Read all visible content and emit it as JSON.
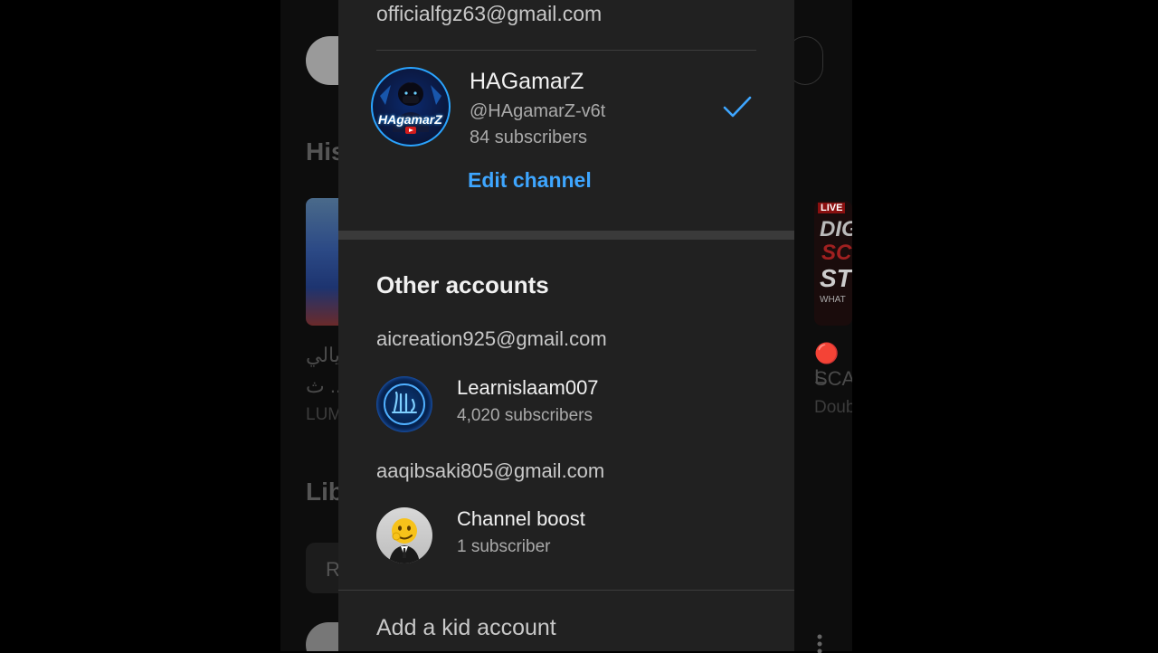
{
  "background": {
    "heading_history": "His",
    "heading_library": "Lib",
    "left_video_text_1": "يالي",
    "left_video_text_2": "ث ...",
    "left_video_channel": "LUM",
    "right_live_badge": "LIVE",
    "right_thumb_text_1": "DIG",
    "right_thumb_text_2": "SC",
    "right_thumb_text_3": "ST",
    "right_thumb_text_4": "WHAT",
    "right_video_title_1": "🔴 L",
    "right_video_title_2": "SCA",
    "right_video_channel": "Doub",
    "library_chip": "R"
  },
  "current_account": {
    "email": "officialfgz63@gmail.com",
    "channel_name": "HAGamarZ",
    "handle": "@HAgamarZ-v6t",
    "subscribers": "84 subscribers",
    "avatar_text": "HAgamarZ",
    "edit_label": "Edit channel"
  },
  "other_accounts": {
    "title": "Other accounts",
    "accounts": [
      {
        "email": "aicreation925@gmail.com",
        "channel_name": "Learnislaam007",
        "subscribers": "4,020 subscribers",
        "avatar": "allah-calligraphy-icon"
      },
      {
        "email": "aaqibsaki805@gmail.com",
        "channel_name": "Channel boost",
        "subscribers": "1 subscriber",
        "avatar": "emoji-suit-icon"
      }
    ]
  },
  "add_kid_label": "Add a kid account",
  "colors": {
    "sheet_bg": "#212121",
    "link_blue": "#3ea6ff",
    "check_blue": "#3ea6ff"
  }
}
